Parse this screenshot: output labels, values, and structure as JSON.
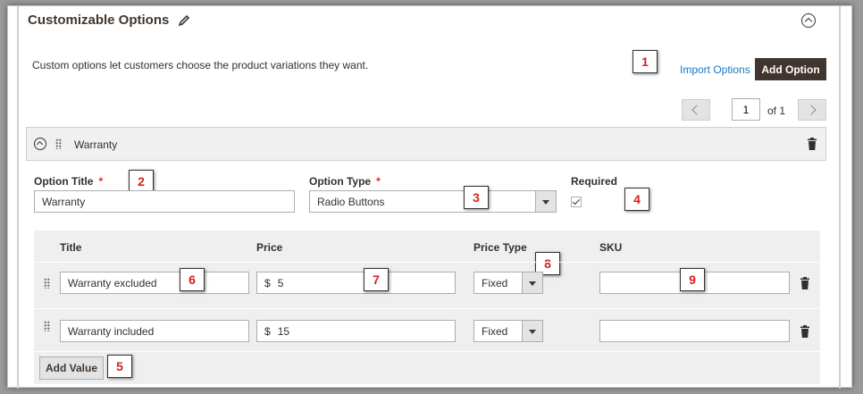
{
  "section": {
    "title": "Customizable Options",
    "description": "Custom options let customers choose the product variations they want."
  },
  "actions": {
    "import_label": "Import Options",
    "add_option_label": "Add Option"
  },
  "pager": {
    "current_page": "1",
    "of_label": "of 1"
  },
  "option": {
    "name": "Warranty",
    "title_label": "Option Title",
    "title_value": "Warranty",
    "type_label": "Option Type",
    "type_value": "Radio Buttons",
    "required_label": "Required",
    "required_checked": true
  },
  "values_grid": {
    "headers": {
      "title": "Title",
      "price": "Price",
      "price_type": "Price Type",
      "sku": "SKU"
    },
    "rows": [
      {
        "title": "Warranty excluded",
        "currency": "$",
        "price": "5",
        "price_type": "Fixed",
        "sku": ""
      },
      {
        "title": "Warranty included",
        "currency": "$",
        "price": "15",
        "price_type": "Fixed",
        "sku": ""
      }
    ],
    "add_value_label": "Add Value"
  },
  "callouts": [
    "1",
    "2",
    "3",
    "4",
    "5",
    "6",
    "7",
    "8",
    "9"
  ],
  "icons": [
    "pencil-icon",
    "collapse-icon",
    "chevron-left-icon",
    "chevron-right-icon",
    "drag-handle-icon",
    "trash-icon",
    "dropdown-arrow-icon",
    "checkmark-icon"
  ],
  "colors": {
    "primary_button": "#41362f",
    "link": "#1979c3",
    "required_star": "#e22626",
    "callout_text": "#d42020"
  }
}
